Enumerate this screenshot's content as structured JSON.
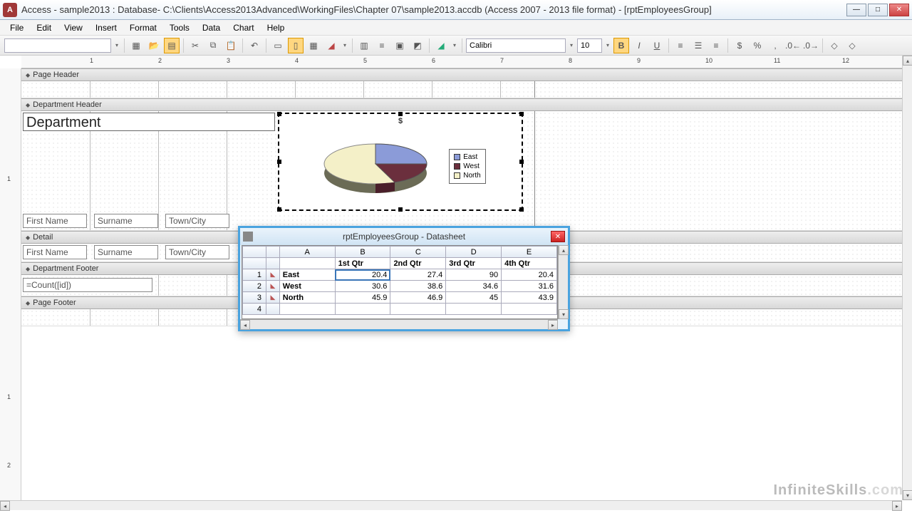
{
  "window": {
    "title": "Access - sample2013 : Database- C:\\Clients\\Access2013Advanced\\WorkingFiles\\Chapter 07\\sample2013.accdb (Access 2007 - 2013 file format) - [rptEmployeesGroup]"
  },
  "menu": [
    "File",
    "Edit",
    "View",
    "Insert",
    "Format",
    "Tools",
    "Data",
    "Chart",
    "Help"
  ],
  "toolbar": {
    "font_name": "Calibri",
    "font_size": "10"
  },
  "ruler_marks": [
    "1",
    "2",
    "3",
    "4",
    "5",
    "6",
    "7",
    "8",
    "9",
    "10",
    "11",
    "12"
  ],
  "sections": {
    "page_header": "Page Header",
    "dept_header": "Department Header",
    "detail": "Detail",
    "dept_footer": "Department Footer",
    "page_footer": "Page Footer"
  },
  "controls": {
    "department_label": "Department",
    "first_name": "First Name",
    "surname": "Surname",
    "town_city": "Town/City",
    "count_expr": "=Count([id])"
  },
  "chart": {
    "title": "$",
    "legend": [
      "East",
      "West",
      "North"
    ]
  },
  "datasheet": {
    "title": "rptEmployeesGroup - Datasheet",
    "col_letters": [
      "A",
      "B",
      "C",
      "D",
      "E"
    ],
    "headers": [
      "",
      "1st Qtr",
      "2nd Qtr",
      "3rd Qtr",
      "4th Qtr"
    ],
    "row_nums": [
      "1",
      "2",
      "3",
      "4"
    ],
    "rows": [
      {
        "name": "East",
        "vals": [
          "20.4",
          "27.4",
          "90",
          "20.4"
        ]
      },
      {
        "name": "West",
        "vals": [
          "30.6",
          "38.6",
          "34.6",
          "31.6"
        ]
      },
      {
        "name": "North",
        "vals": [
          "45.9",
          "46.9",
          "45",
          "43.9"
        ]
      }
    ]
  },
  "watermark": {
    "a": "InfiniteSkills",
    "b": ".com"
  },
  "chart_data": {
    "type": "pie",
    "title": "$",
    "categories": [
      "East",
      "West",
      "North"
    ],
    "series": [
      {
        "name": "1st Qtr",
        "values": [
          20.4,
          30.6,
          45.9
        ]
      },
      {
        "name": "2nd Qtr",
        "values": [
          27.4,
          38.6,
          46.9
        ]
      },
      {
        "name": "3rd Qtr",
        "values": [
          90,
          34.6,
          45
        ]
      },
      {
        "name": "4th Qtr",
        "values": [
          20.4,
          31.6,
          43.9
        ]
      }
    ],
    "note": "3D pie preview shown in Access chart control; datasheet shows underlying quarterly figures per region"
  }
}
